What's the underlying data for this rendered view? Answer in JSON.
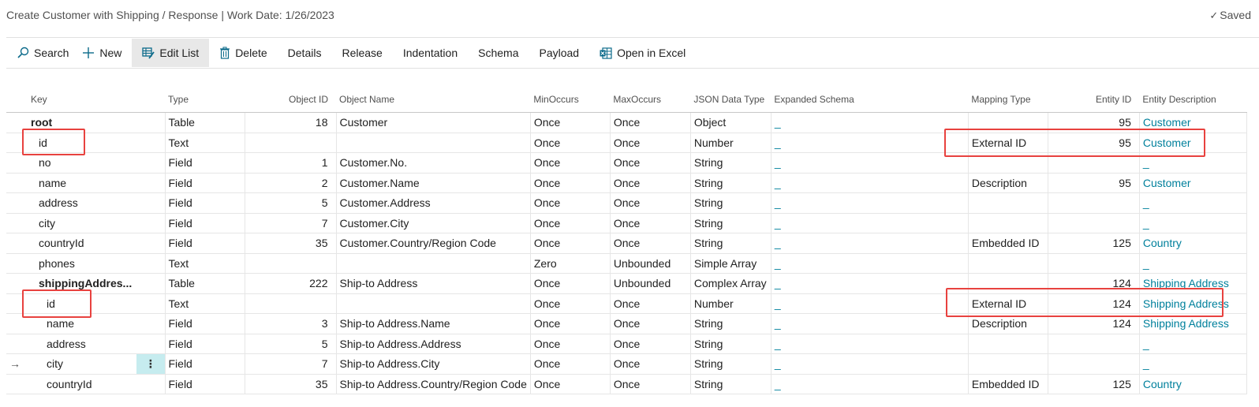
{
  "header": {
    "title": "Create Customer with Shipping / Response | Work Date: 1/26/2023",
    "saved_label": "Saved"
  },
  "toolbar": {
    "search": "Search",
    "new": "New",
    "edit_list": "Edit List",
    "delete": "Delete",
    "details": "Details",
    "release": "Release",
    "indentation": "Indentation",
    "schema": "Schema",
    "payload": "Payload",
    "open_in_excel": "Open in Excel"
  },
  "columns": {
    "key": "Key",
    "type": "Type",
    "object_id": "Object ID",
    "object_name": "Object Name",
    "min_occurs": "MinOccurs",
    "max_occurs": "MaxOccurs",
    "json_data_type": "JSON Data Type",
    "expanded_schema": "Expanded Schema",
    "mapping_type": "Mapping Type",
    "entity_id": "Entity ID",
    "entity_description": "Entity Description"
  },
  "rows": [
    {
      "key": "root",
      "type": "Table",
      "object_id": "18",
      "object_name": "Customer",
      "min": "Once",
      "max": "Once",
      "json": "Object",
      "schema": "_",
      "mapping": "",
      "entity_id": "95",
      "entity_desc": "Customer"
    },
    {
      "key": "id",
      "type": "Text",
      "object_id": "",
      "object_name": "",
      "min": "Once",
      "max": "Once",
      "json": "Number",
      "schema": "_",
      "mapping": "External ID",
      "entity_id": "95",
      "entity_desc": "Customer"
    },
    {
      "key": "no",
      "type": "Field",
      "object_id": "1",
      "object_name": "Customer.No.",
      "min": "Once",
      "max": "Once",
      "json": "String",
      "schema": "_",
      "mapping": "",
      "entity_id": "",
      "entity_desc": "_"
    },
    {
      "key": "name",
      "type": "Field",
      "object_id": "2",
      "object_name": "Customer.Name",
      "min": "Once",
      "max": "Once",
      "json": "String",
      "schema": "_",
      "mapping": "Description",
      "entity_id": "95",
      "entity_desc": "Customer"
    },
    {
      "key": "address",
      "type": "Field",
      "object_id": "5",
      "object_name": "Customer.Address",
      "min": "Once",
      "max": "Once",
      "json": "String",
      "schema": "_",
      "mapping": "",
      "entity_id": "",
      "entity_desc": "_"
    },
    {
      "key": "city",
      "type": "Field",
      "object_id": "7",
      "object_name": "Customer.City",
      "min": "Once",
      "max": "Once",
      "json": "String",
      "schema": "_",
      "mapping": "",
      "entity_id": "",
      "entity_desc": "_"
    },
    {
      "key": "countryId",
      "type": "Field",
      "object_id": "35",
      "object_name": "Customer.Country/Region Code",
      "min": "Once",
      "max": "Once",
      "json": "String",
      "schema": "_",
      "mapping": "Embedded ID",
      "entity_id": "125",
      "entity_desc": "Country"
    },
    {
      "key": "phones",
      "type": "Text",
      "object_id": "",
      "object_name": "",
      "min": "Zero",
      "max": "Unbounded",
      "json": "Simple Array",
      "schema": "_",
      "mapping": "",
      "entity_id": "",
      "entity_desc": "_"
    },
    {
      "key": "shippingAddres...",
      "type": "Table",
      "object_id": "222",
      "object_name": "Ship-to Address",
      "min": "Once",
      "max": "Unbounded",
      "json": "Complex Array",
      "schema": "_",
      "mapping": "",
      "entity_id": "124",
      "entity_desc": "Shipping Address"
    },
    {
      "key": "id",
      "type": "Text",
      "object_id": "",
      "object_name": "",
      "min": "Once",
      "max": "Once",
      "json": "Number",
      "schema": "_",
      "mapping": "External ID",
      "entity_id": "124",
      "entity_desc": "Shipping Address"
    },
    {
      "key": "name",
      "type": "Field",
      "object_id": "3",
      "object_name": "Ship-to Address.Name",
      "min": "Once",
      "max": "Once",
      "json": "String",
      "schema": "_",
      "mapping": "Description",
      "entity_id": "124",
      "entity_desc": "Shipping Address"
    },
    {
      "key": "address",
      "type": "Field",
      "object_id": "5",
      "object_name": "Ship-to Address.Address",
      "min": "Once",
      "max": "Once",
      "json": "String",
      "schema": "_",
      "mapping": "",
      "entity_id": "",
      "entity_desc": "_"
    },
    {
      "key": "city",
      "type": "Field",
      "object_id": "7",
      "object_name": "Ship-to Address.City",
      "min": "Once",
      "max": "Once",
      "json": "String",
      "schema": "_",
      "mapping": "",
      "entity_id": "",
      "entity_desc": "_"
    },
    {
      "key": "countryId",
      "type": "Field",
      "object_id": "35",
      "object_name": "Ship-to Address.Country/Region Code",
      "min": "Once",
      "max": "Once",
      "json": "String",
      "schema": "_",
      "mapping": "Embedded ID",
      "entity_id": "125",
      "entity_desc": "Country"
    }
  ],
  "row_meta": {
    "current_row_marker": "→",
    "menu_dots": "⋮"
  },
  "colors": {
    "link": "#00809c",
    "highlight_box": "#e8423f",
    "selected_cell": "#c6ecef"
  }
}
